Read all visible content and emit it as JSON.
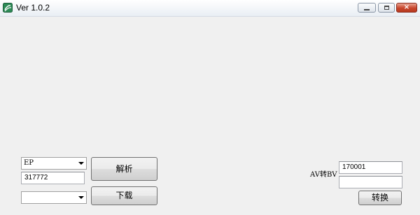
{
  "window": {
    "title": "Ver 1.0.2",
    "icon": "app-logo-icon",
    "controls": {
      "minimize": "minimize-icon",
      "maximize": "maximize-icon",
      "close": "×"
    }
  },
  "left_panel": {
    "type_select_value": "EP",
    "id_input_value": "317772",
    "quality_select_value": "",
    "parse_button_label": "解析",
    "download_button_label": "下载"
  },
  "right_panel": {
    "av_label": "AV转BV",
    "av_input_value": "170001",
    "bv_output_value": "",
    "convert_button_label": "转换"
  }
}
